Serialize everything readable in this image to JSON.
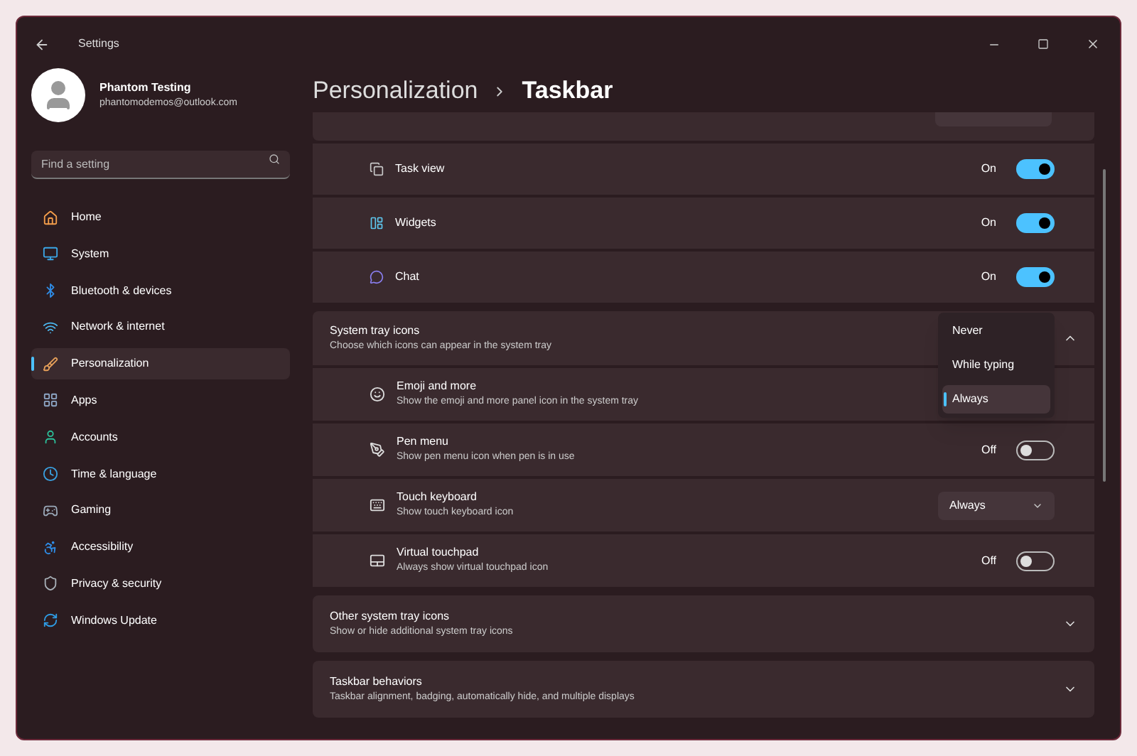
{
  "window": {
    "title": "Settings"
  },
  "account": {
    "name": "Phantom Testing",
    "email": "phantomodemos@outlook.com"
  },
  "search": {
    "placeholder": "Find a setting"
  },
  "sidebar": {
    "items": [
      {
        "label": "Home",
        "selected": false
      },
      {
        "label": "System",
        "selected": false
      },
      {
        "label": "Bluetooth & devices",
        "selected": false
      },
      {
        "label": "Network & internet",
        "selected": false
      },
      {
        "label": "Personalization",
        "selected": true
      },
      {
        "label": "Apps",
        "selected": false
      },
      {
        "label": "Accounts",
        "selected": false
      },
      {
        "label": "Time & language",
        "selected": false
      },
      {
        "label": "Gaming",
        "selected": false
      },
      {
        "label": "Accessibility",
        "selected": false
      },
      {
        "label": "Privacy & security",
        "selected": false
      },
      {
        "label": "Windows Update",
        "selected": false
      }
    ]
  },
  "breadcrumb": [
    "Personalization",
    "Taskbar"
  ],
  "taskbar_items": [
    {
      "label": "Task view",
      "state": "On",
      "on": true
    },
    {
      "label": "Widgets",
      "state": "On",
      "on": true
    },
    {
      "label": "Chat",
      "state": "On",
      "on": true
    }
  ],
  "system_tray": {
    "title": "System tray icons",
    "subtitle": "Choose which icons can appear in the system tray",
    "expanded": true,
    "items": [
      {
        "kind": "covered",
        "title": "Emoji and more",
        "subtitle": "Show the emoji and more panel icon in the system tray"
      },
      {
        "kind": "toggle",
        "title": "Pen menu",
        "subtitle": "Show pen menu icon when pen is in use",
        "state": "Off",
        "on": false
      },
      {
        "kind": "dropdown",
        "title": "Touch keyboard",
        "subtitle": "Show touch keyboard icon",
        "value": "Always"
      },
      {
        "kind": "toggle",
        "title": "Virtual touchpad",
        "subtitle": "Always show virtual touchpad icon",
        "state": "Off",
        "on": false
      }
    ],
    "menu": {
      "options": [
        {
          "label": "Never",
          "selected": false
        },
        {
          "label": "While typing",
          "selected": false
        },
        {
          "label": "Always",
          "selected": true
        }
      ]
    }
  },
  "sections": [
    {
      "title": "Other system tray icons",
      "subtitle": "Show or hide additional system tray icons",
      "expanded": false
    },
    {
      "title": "Taskbar behaviors",
      "subtitle": "Taskbar alignment, badging, automatically hide, and multiple displays",
      "expanded": false
    }
  ]
}
